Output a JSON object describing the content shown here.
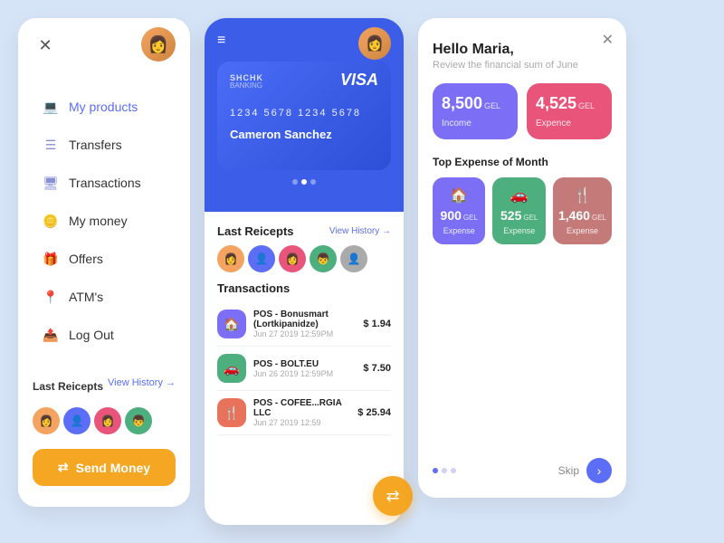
{
  "leftPanel": {
    "closeIcon": "✕",
    "profileEmoji": "👩",
    "navItems": [
      {
        "id": "my-products",
        "label": "My products",
        "icon": "💻",
        "active": true
      },
      {
        "id": "transfers",
        "label": "Transfers",
        "icon": "☰",
        "active": false
      },
      {
        "id": "transactions",
        "label": "Transactions",
        "icon": "🖥",
        "active": false
      },
      {
        "id": "my-money",
        "label": "My money",
        "icon": "🪙",
        "active": false
      },
      {
        "id": "offers",
        "label": "Offers",
        "icon": "🎁",
        "active": false
      },
      {
        "id": "atms",
        "label": "ATM's",
        "icon": "📍",
        "active": false
      },
      {
        "id": "logout",
        "label": "Log Out",
        "icon": "📤",
        "active": false
      }
    ],
    "lastReceipts": "Last Reicepts",
    "viewHistory": "View History →",
    "avatars": [
      "#f4a460",
      "#5b6ef5",
      "#e8547a",
      "#4caf7d"
    ],
    "sendMoneyLabel": "Send Money",
    "sendMoneyIcon": "⇄"
  },
  "middlePanel": {
    "hamburgerIcon": "≡",
    "profileEmoji": "👩",
    "card": {
      "bankLabel": "SHCHK",
      "bankSub": "BANKING",
      "visaLabel": "VISA",
      "number": "1234  5678  1234  5678",
      "name": "Cameron Sanchez"
    },
    "cardDots": [
      false,
      true,
      false
    ],
    "lastReceipts": "Last Reicepts",
    "viewHistory": "View History →",
    "avatarColors": [
      "#f4a460",
      "#5b6ef5",
      "#e8547a",
      "#4caf7d",
      "#aaa"
    ],
    "transactionsTitle": "Transactions",
    "transactions": [
      {
        "icon": "🏠",
        "iconBg": "purple",
        "name": "POS - Bonusmart (Lortkipanidze)",
        "date": "Jun 27 2019 12:59PM",
        "amount": "$ 1.94"
      },
      {
        "icon": "🚗",
        "iconBg": "green",
        "name": "POS - BOLT.EU",
        "date": "Jun 26 2019 12:59PM",
        "amount": "$ 7.50"
      },
      {
        "icon": "🍴",
        "iconBg": "red",
        "name": "POS - COFEE...RGIA LLC",
        "date": "Jun 27 2019 12:59",
        "amount": "$ 25.94"
      }
    ],
    "fabIcon": "⇄"
  },
  "rightPanel": {
    "closeIcon": "✕",
    "greeting": "Hello ",
    "name": "Maria,",
    "subtext": "Review the financial sum of June",
    "income": {
      "amount": "8,500",
      "unit": "GEL",
      "label": "Income"
    },
    "expense": {
      "amount": "4,525",
      "unit": "GEL",
      "label": "Expence"
    },
    "topExpenseTitle": "Top Expense of Month",
    "expenseCards": [
      {
        "icon": "🏠",
        "value": "900",
        "unit": "GEL",
        "label": "Expense",
        "colorClass": "purple-card"
      },
      {
        "icon": "🚗",
        "value": "525",
        "unit": "GEL",
        "label": "Expense",
        "colorClass": "green-card"
      },
      {
        "icon": "🍴",
        "value": "1,460",
        "unit": "GEL",
        "label": "Expense",
        "colorClass": "rose-card"
      }
    ],
    "skipLabel": "Skip",
    "skipIcon": "›",
    "dots": [
      true,
      false,
      false
    ]
  }
}
